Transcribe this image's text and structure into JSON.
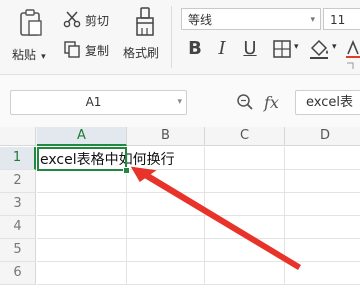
{
  "ribbon": {
    "paste_label": "粘贴",
    "cut_label": "剪切",
    "copy_label": "复制",
    "format_painter_label": "格式刷",
    "font_name": "等线",
    "font_size": "11",
    "bold": "B",
    "italic": "I",
    "underline": "U"
  },
  "formula_bar": {
    "cell_ref": "A1",
    "fx": "fx",
    "content": "excel表"
  },
  "sheet": {
    "columns": [
      "A",
      "B",
      "C",
      "D"
    ],
    "rows": [
      "1",
      "2",
      "3",
      "4",
      "5",
      "6"
    ],
    "a1_value": "excel表格中如何换行"
  },
  "colors": {
    "selection": "#20883f",
    "arrow": "#e8332a"
  }
}
